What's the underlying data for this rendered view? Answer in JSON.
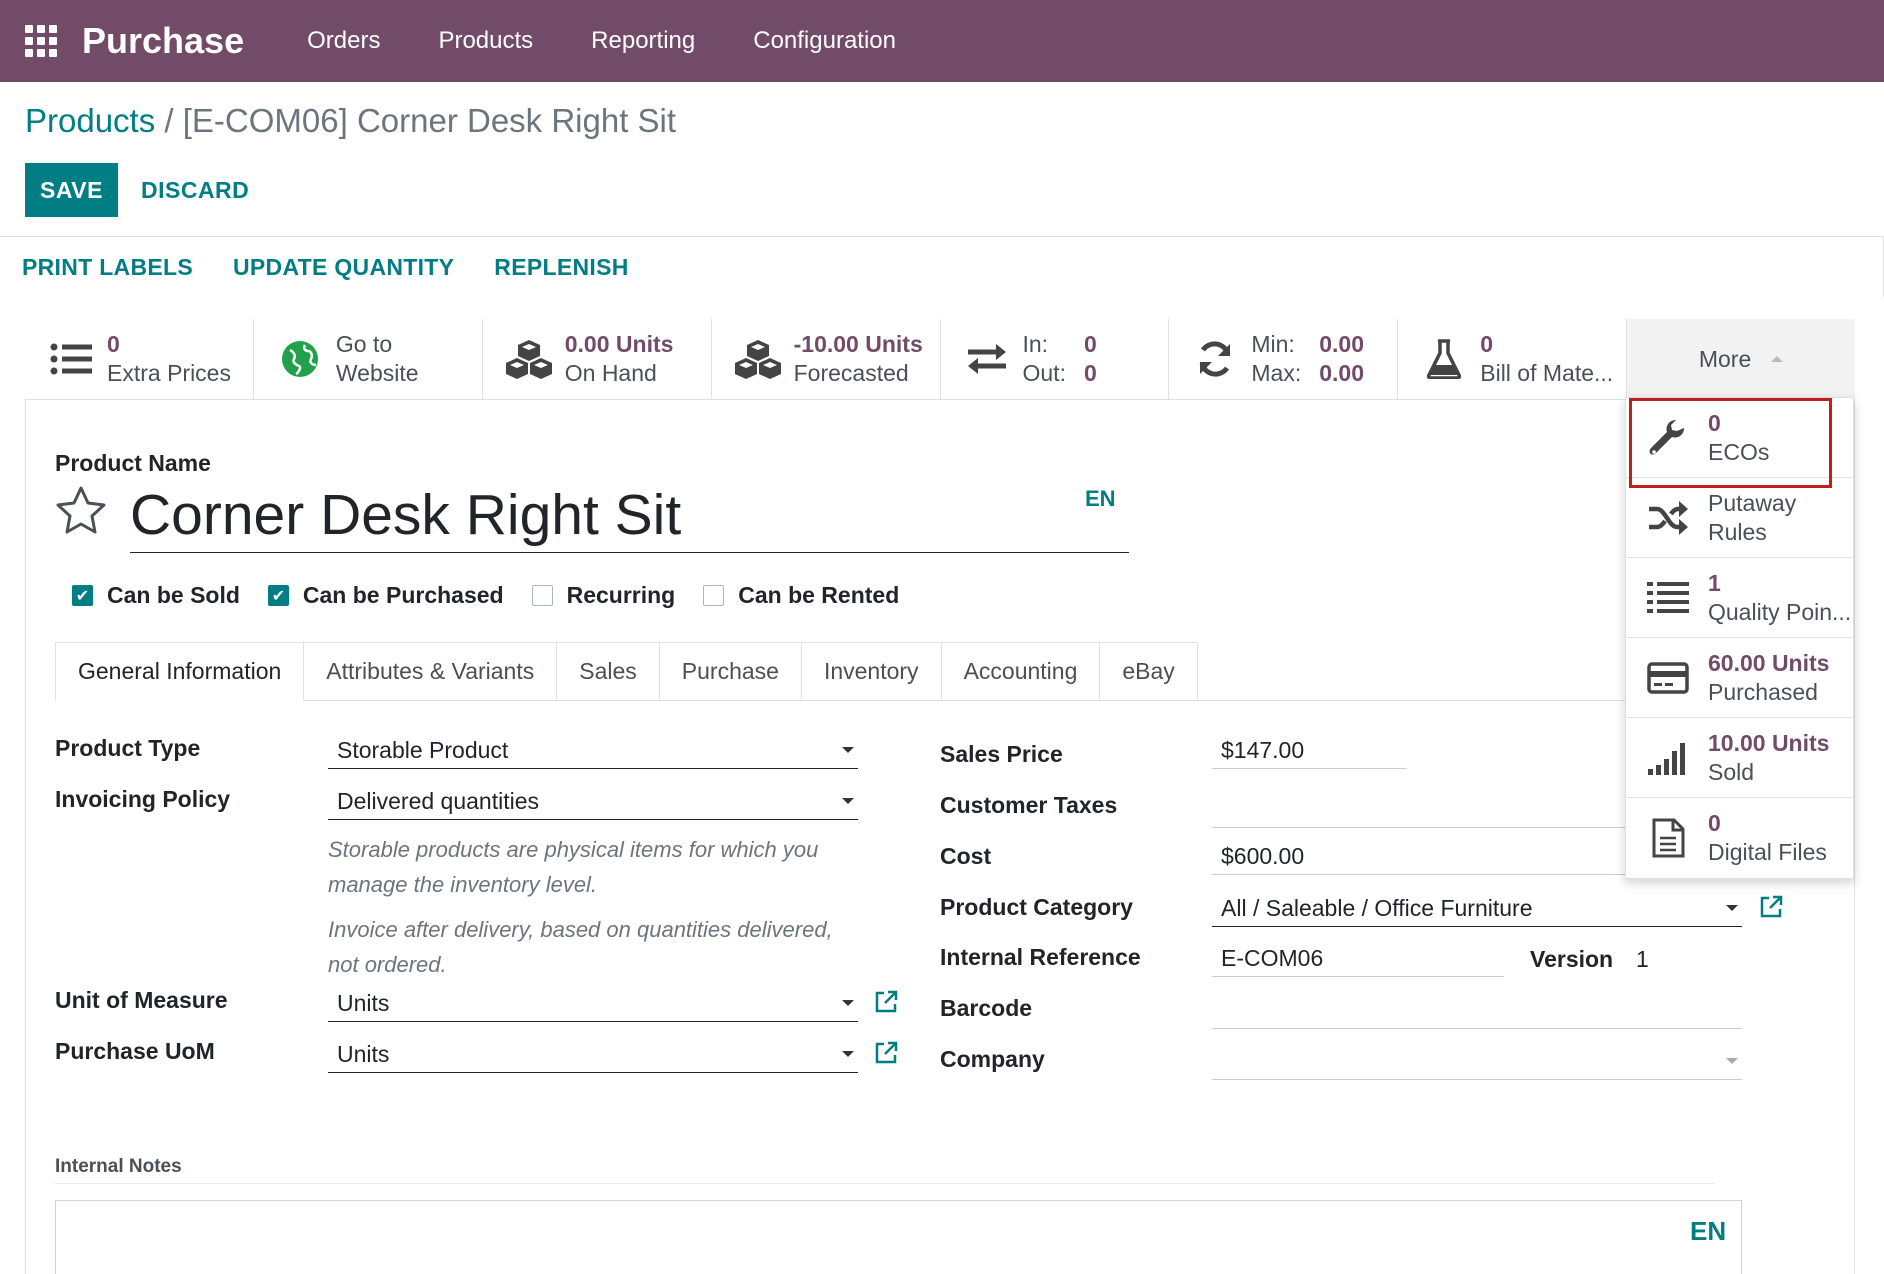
{
  "nav": {
    "brand": "Purchase",
    "menu": [
      "Orders",
      "Products",
      "Reporting",
      "Configuration"
    ]
  },
  "breadcrumb": {
    "parent": "Products",
    "separator": " / ",
    "current": "[E-COM06] Corner Desk Right Sit"
  },
  "actions": {
    "save": "SAVE",
    "discard": "DISCARD"
  },
  "statusbar": {
    "buttons": [
      "PRINT LABELS",
      "UPDATE QUANTITY",
      "REPLENISH"
    ]
  },
  "smart_buttons": {
    "extra_prices": {
      "value": "0",
      "label": "Extra Prices"
    },
    "website": {
      "line1": "Go to",
      "line2": "Website"
    },
    "on_hand": {
      "value": "0.00 Units",
      "label": "On Hand"
    },
    "forecasted": {
      "value": "-10.00 Units",
      "label": "Forecasted"
    },
    "in_out": {
      "in_label": "In:",
      "in_value": "0",
      "out_label": "Out:",
      "out_value": "0"
    },
    "min_max": {
      "min_label": "Min:",
      "min_value": "0.00",
      "max_label": "Max:",
      "max_value": "0.00"
    },
    "bom": {
      "value": "0",
      "label": "Bill of Mate..."
    },
    "more": "More"
  },
  "more_dropdown": [
    {
      "value": "0",
      "label": "ECOs",
      "icon": "wrench-icon"
    },
    {
      "value": "",
      "label": "Putaway Rules",
      "icon": "shuffle-icon"
    },
    {
      "value": "1",
      "label": "Quality Poin...",
      "icon": "list-icon"
    },
    {
      "value": "60.00 Units",
      "label": "Purchased",
      "icon": "credit-card-icon"
    },
    {
      "value": "10.00 Units",
      "label": "Sold",
      "icon": "signal-icon"
    },
    {
      "value": "0",
      "label": "Digital Files",
      "icon": "file-icon"
    }
  ],
  "form": {
    "product_name_label": "Product Name",
    "product_name": "Corner Desk Right Sit",
    "lang": "EN",
    "checkboxes": [
      {
        "label": "Can be Sold",
        "checked": true
      },
      {
        "label": "Can be Purchased",
        "checked": true
      },
      {
        "label": "Recurring",
        "checked": false
      },
      {
        "label": "Can be Rented",
        "checked": false
      }
    ],
    "tabs": [
      "General Information",
      "Attributes & Variants",
      "Sales",
      "Purchase",
      "Inventory",
      "Accounting",
      "eBay"
    ],
    "left": {
      "product_type_label": "Product Type",
      "product_type": "Storable Product",
      "invoicing_policy_label": "Invoicing Policy",
      "invoicing_policy": "Delivered quantities",
      "help_type": "Storable products are physical items for which you manage the inventory level.",
      "help_invoice": "Invoice after delivery, based on quantities delivered, not ordered.",
      "uom_label": "Unit of Measure",
      "uom": "Units",
      "purchase_uom_label": "Purchase UoM",
      "purchase_uom": "Units"
    },
    "right": {
      "sales_price_label": "Sales Price",
      "sales_price": "$147.00",
      "customer_taxes_label": "Customer Taxes",
      "customer_taxes": "",
      "cost_label": "Cost",
      "cost": "$600.00",
      "category_label": "Product Category",
      "category": "All / Saleable / Office Furniture",
      "internal_ref_label": "Internal Reference",
      "internal_ref": "E-COM06",
      "version_label": "Version",
      "version": "1",
      "barcode_label": "Barcode",
      "barcode": "",
      "company_label": "Company",
      "company": ""
    },
    "internal_notes_label": "Internal Notes"
  },
  "colors": {
    "nav": "#714b67",
    "accent": "#017e84",
    "value": "#714b67",
    "highlight": "#c0201b"
  }
}
